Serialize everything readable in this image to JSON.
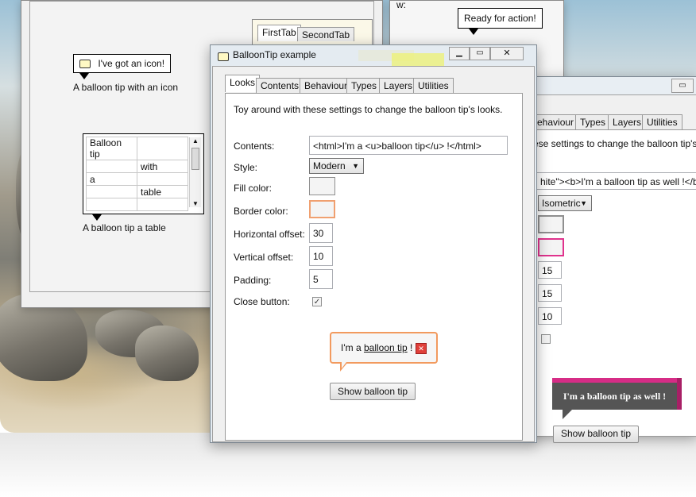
{
  "bg_window": {
    "icon_tip": {
      "text": "I've got an icon!",
      "caption": "A balloon tip with an icon"
    },
    "table_tip": {
      "rows": [
        [
          "Balloon tip",
          ""
        ],
        [
          "",
          "with"
        ],
        [
          "a",
          ""
        ],
        [
          "",
          "table"
        ],
        [
          "",
          ""
        ],
        [
          "",
          ""
        ]
      ],
      "caption": "A balloon tip a table"
    },
    "tabs": {
      "first": "FirstTab",
      "second": "SecondTab"
    }
  },
  "action_tip": {
    "text": "Ready for action!"
  },
  "second_window": {
    "prefix": "w:"
  },
  "main_window": {
    "title": "BalloonTip example",
    "tabs": [
      "Looks",
      "Contents",
      "Behaviour",
      "Types",
      "Layers",
      "Utilities"
    ],
    "intro": "Toy around with these settings to change the balloon tip's looks.",
    "labels": {
      "contents": "Contents:",
      "style": "Style:",
      "fill": "Fill color:",
      "border": "Border color:",
      "hoffset": "Horizontal offset:",
      "voffset": "Vertical offset:",
      "padding": "Padding:",
      "close": "Close button:"
    },
    "values": {
      "contents": "<html>I'm a <u>balloon tip</u> !</html>",
      "style": "Modern",
      "hoffset": "30",
      "voffset": "10",
      "padding": "5"
    },
    "colors": {
      "fill": "#f4f4f4",
      "border": "#f0a070",
      "balloon_border": "#f29a5e"
    },
    "close_checked": "✓",
    "balloon": {
      "prefix": "I'm a ",
      "link": "balloon tip",
      "suffix": " !"
    },
    "show_button": "Show balloon tip"
  },
  "right_window": {
    "tabs": [
      "ehaviour",
      "Types",
      "Layers",
      "Utilities"
    ],
    "intro": "ese settings to change the balloon tip's looks.",
    "contents": "hite\"><b>I'm a balloon tip as well !</b><",
    "style": "Isometric",
    "hoffset": "15",
    "voffset": "15",
    "padding": "10",
    "colors": {
      "fill": "#f2f2f2",
      "border": "#e0338d",
      "balloon_bg": "#555555",
      "balloon_top": "#d62c86"
    },
    "balloon_text": "I'm a balloon tip as well !",
    "show_button": "Show balloon tip"
  }
}
